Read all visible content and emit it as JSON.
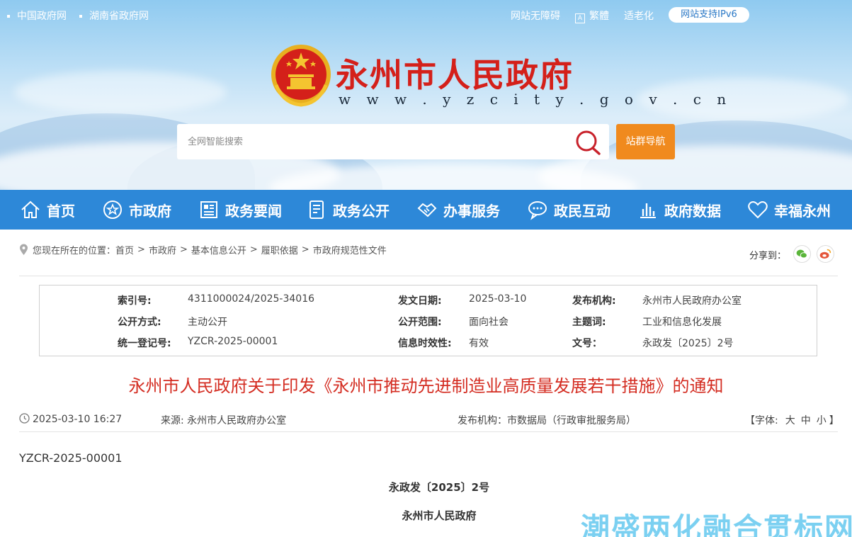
{
  "topbar": {
    "left_links": [
      "中国政府网",
      "湖南省政府网"
    ],
    "accessibility": "网站无障碍",
    "traditional": "繁體",
    "elderly": "适老化",
    "ipv6": "网站支持IPv6"
  },
  "header": {
    "title": "永州市人民政府",
    "url": "w w w . y z c i t y . g o v . c n",
    "search_placeholder": "全网智能搜索",
    "site_nav_button": "站群导航"
  },
  "nav": [
    {
      "label": "首页",
      "icon": "home-icon"
    },
    {
      "label": "市政府",
      "icon": "star-circle-icon"
    },
    {
      "label": "政务要闻",
      "icon": "newspaper-icon"
    },
    {
      "label": "政务公开",
      "icon": "document-icon"
    },
    {
      "label": "办事服务",
      "icon": "handshake-icon"
    },
    {
      "label": "政民互动",
      "icon": "chat-icon"
    },
    {
      "label": "政府数据",
      "icon": "bar-chart-icon"
    },
    {
      "label": "幸福永州",
      "icon": "heart-icon"
    }
  ],
  "breadcrumb": {
    "prefix": "您现在所在的位置：",
    "items": [
      "首页",
      "市政府",
      "基本信息公开",
      "履职依据",
      "市政府规范性文件"
    ],
    "separator": ">"
  },
  "share": {
    "label": "分享到：",
    "icons": [
      "wechat-icon",
      "weibo-icon"
    ]
  },
  "info": {
    "row1": {
      "k1": "索引号:",
      "v1": "4311000024/2025-34016",
      "k2": "发文日期:",
      "v2": "2025-03-10",
      "k3": "发布机构:",
      "v3": "永州市人民政府办公室"
    },
    "row2": {
      "k1": "公开方式:",
      "v1": "主动公开",
      "k2": "公开范围:",
      "v2": "面向社会",
      "k3": "主题词:",
      "v3": "工业和信息化发展"
    },
    "row3": {
      "k1": "统一登记号:",
      "v1": "YZCR-2025-00001",
      "k2": "信息时效性:",
      "v2": "有效",
      "k3": "文号：",
      "v3": "永政发〔2025〕2号"
    }
  },
  "article": {
    "title": "永州市人民政府关于印发《永州市推动先进制造业高质量发展若干措施》的通知",
    "datetime": "2025-03-10 16:27",
    "source": "来源:   永州市人民政府办公室",
    "publisher": "发布机构：市数据局（行政审批服务局）",
    "font_label": "【字体:",
    "font_sizes": [
      "大",
      "中",
      "小"
    ],
    "font_close": "】",
    "doc_reg": "YZCR-2025-00001",
    "doc_no": "永政发〔2025〕2号",
    "issuer": "永州市人民政府"
  },
  "watermark": "潮盛两化融合贯标网",
  "colors": {
    "nav_bg": "#2d88d8",
    "title_red": "#d42d22",
    "orange": "#f08a1e"
  }
}
